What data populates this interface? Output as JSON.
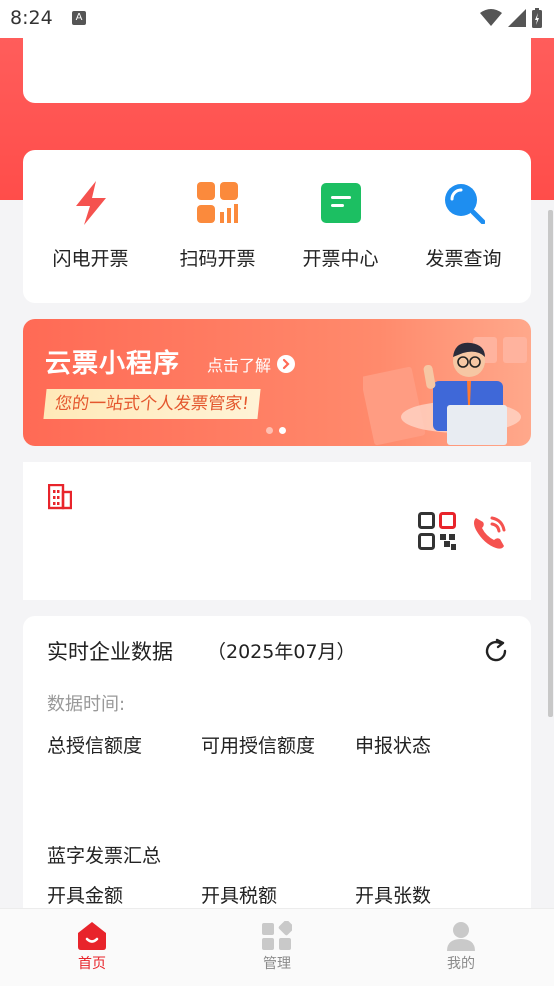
{
  "status_bar": {
    "time": "8:24",
    "notification_letter": "A"
  },
  "quick_actions": [
    {
      "label": "闪电开票",
      "icon": "lightning-icon"
    },
    {
      "label": "扫码开票",
      "icon": "scan-code-icon"
    },
    {
      "label": "开票中心",
      "icon": "invoice-center-icon"
    },
    {
      "label": "发票查询",
      "icon": "search-icon"
    }
  ],
  "banner": {
    "title": "云票小程序",
    "link_label": "点击了解",
    "tagline": "您的一站式个人发票管家!",
    "active_slide": 2,
    "slide_count": 2
  },
  "data_section": {
    "title": "实时企业数据",
    "month": "（2025年07月）",
    "time_label": "数据时间:",
    "credit_row": [
      "总授信额度",
      "可用授信额度",
      "申报状态"
    ],
    "blue_summary_title": "蓝字发票汇总",
    "issue_row": [
      "开具金额",
      "开具税额",
      "开具张数"
    ]
  },
  "bottom_nav": [
    {
      "label": "首页",
      "icon": "home-icon",
      "active": true
    },
    {
      "label": "管理",
      "icon": "manage-icon",
      "active": false
    },
    {
      "label": "我的",
      "icon": "profile-icon",
      "active": false
    }
  ],
  "colors": {
    "brand_red": "#ff4d4a",
    "active_nav": "#e8242b",
    "inactive_nav": "#8a8a8a"
  }
}
